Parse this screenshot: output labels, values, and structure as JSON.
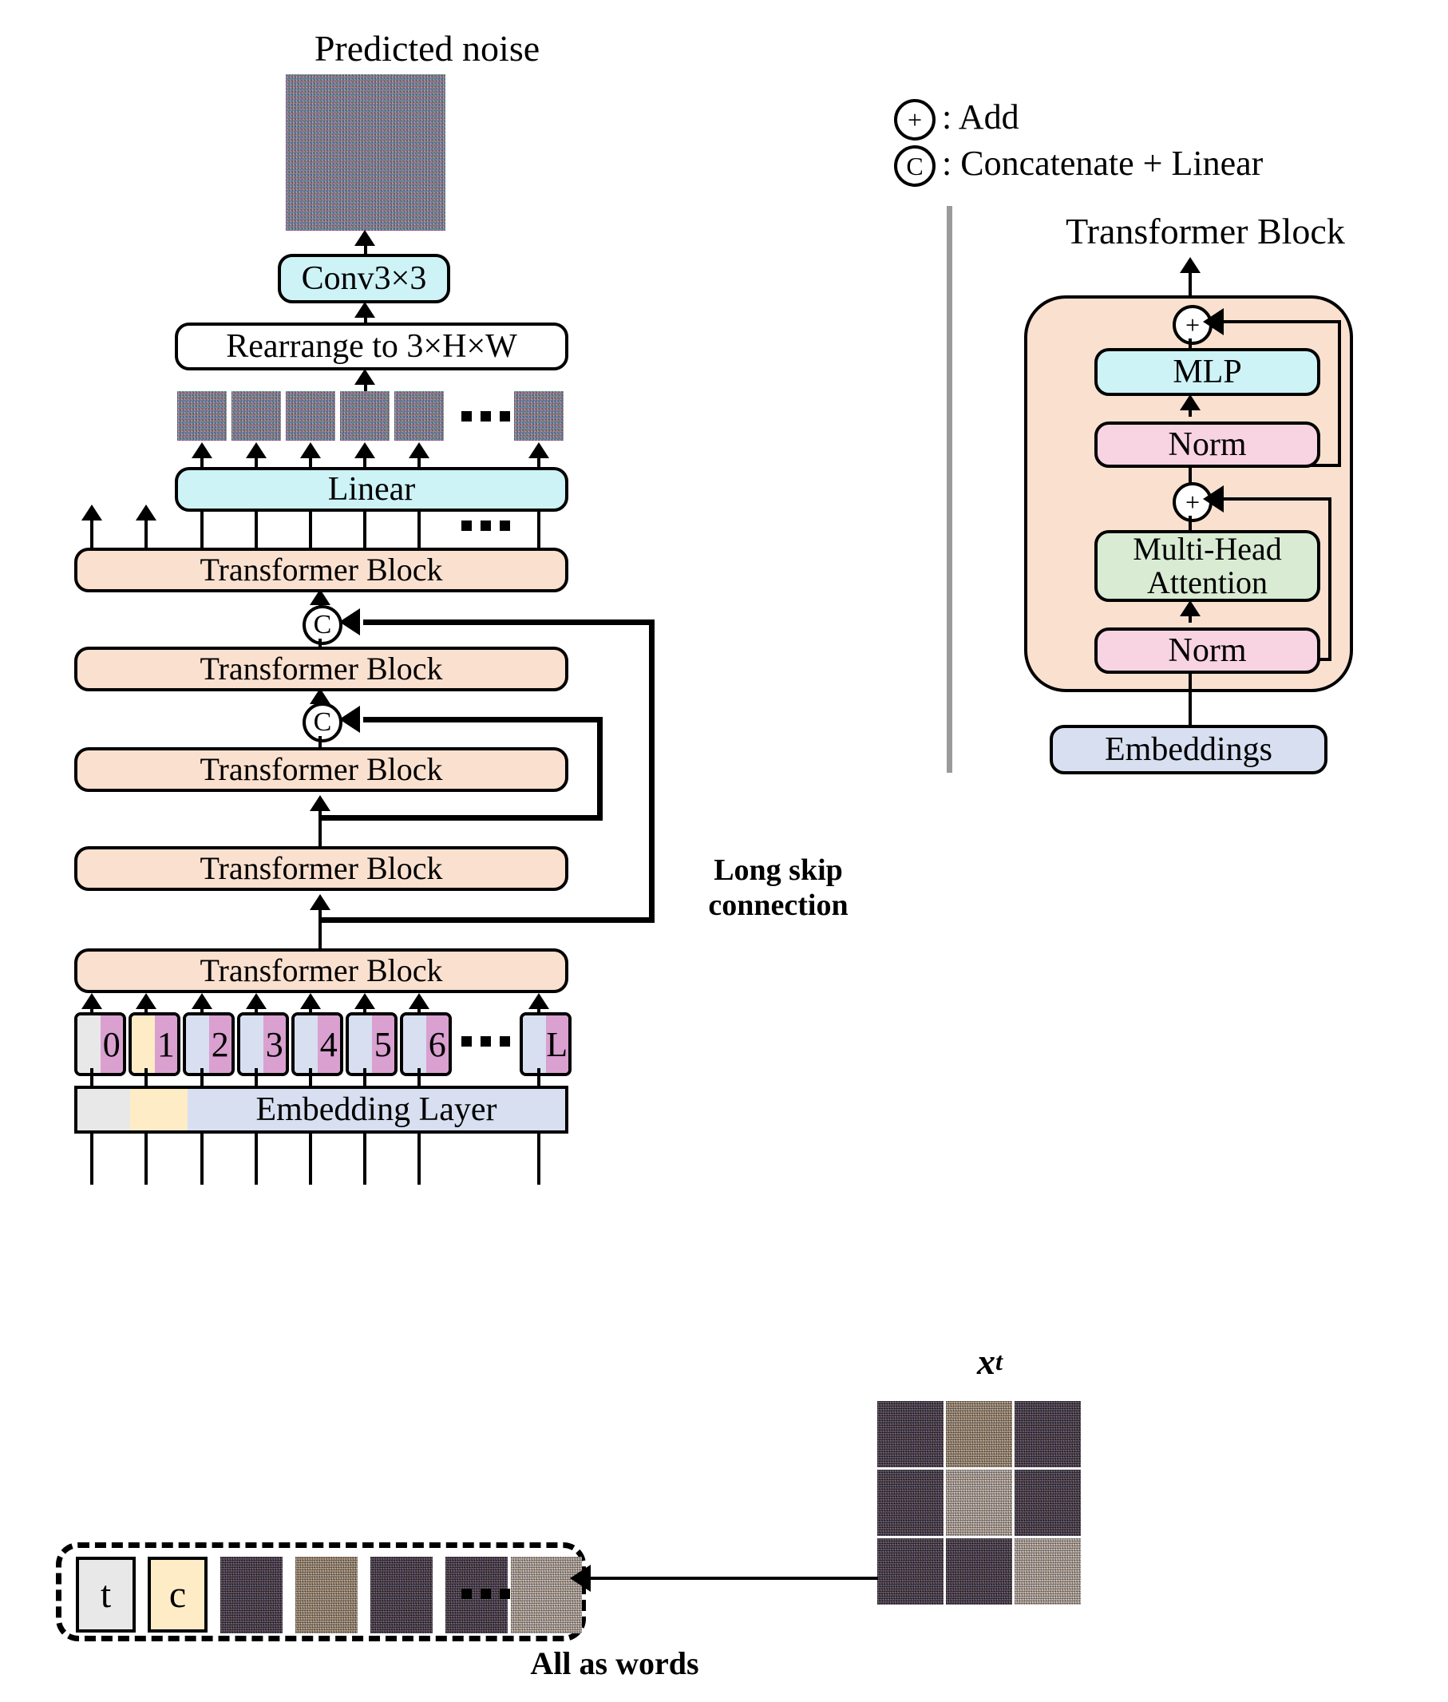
{
  "figure": {
    "predicted_noise_label": "Predicted noise",
    "xt_label": "x",
    "xt_sub": "t",
    "all_as_words_label": "All as words",
    "long_skip_label_1": "Long skip",
    "long_skip_label_2": "connection"
  },
  "legend": {
    "add_symbol": "+",
    "add_text": ": Add",
    "concat_symbol": "C",
    "concat_text": ": Concatenate + Linear"
  },
  "main_pipeline": {
    "conv_label": "Conv3×3",
    "rearrange_label": "Rearrange to 3×H×W",
    "linear_label": "Linear",
    "transformer_blocks": [
      "Transformer Block",
      "Transformer Block",
      "Transformer Block",
      "Transformer Block",
      "Transformer Block"
    ],
    "embedding_layer_label": "Embedding Layer",
    "concat_junctions": [
      "C",
      "C"
    ],
    "ellipsis": "···"
  },
  "tokens": {
    "embedded": [
      "0",
      "1",
      "2",
      "3",
      "4",
      "5",
      "6",
      "L"
    ],
    "ellipsis": "···",
    "inputs": [
      "t",
      "c"
    ]
  },
  "transformer_detail": {
    "title": "Transformer Block",
    "mlp_label": "MLP",
    "norm_top_label": "Norm",
    "attention_label_1": "Multi-Head",
    "attention_label_2": "Attention",
    "norm_bottom_label": "Norm",
    "embeddings_label": "Embeddings",
    "add_symbol_top": "+",
    "add_symbol_bottom": "+"
  },
  "colors": {
    "transformer_block": "#fae0cf",
    "cyan_box": "#cdf3f7",
    "pink_box": "#f8d3e2",
    "green_box": "#d9ebd3",
    "lavender_box": "#d7dff0",
    "token_right": "#d9a0d0",
    "token_gray": "#e8e8e8",
    "token_yellow": "#fdecc6",
    "token_blue": "#d7dff0"
  }
}
